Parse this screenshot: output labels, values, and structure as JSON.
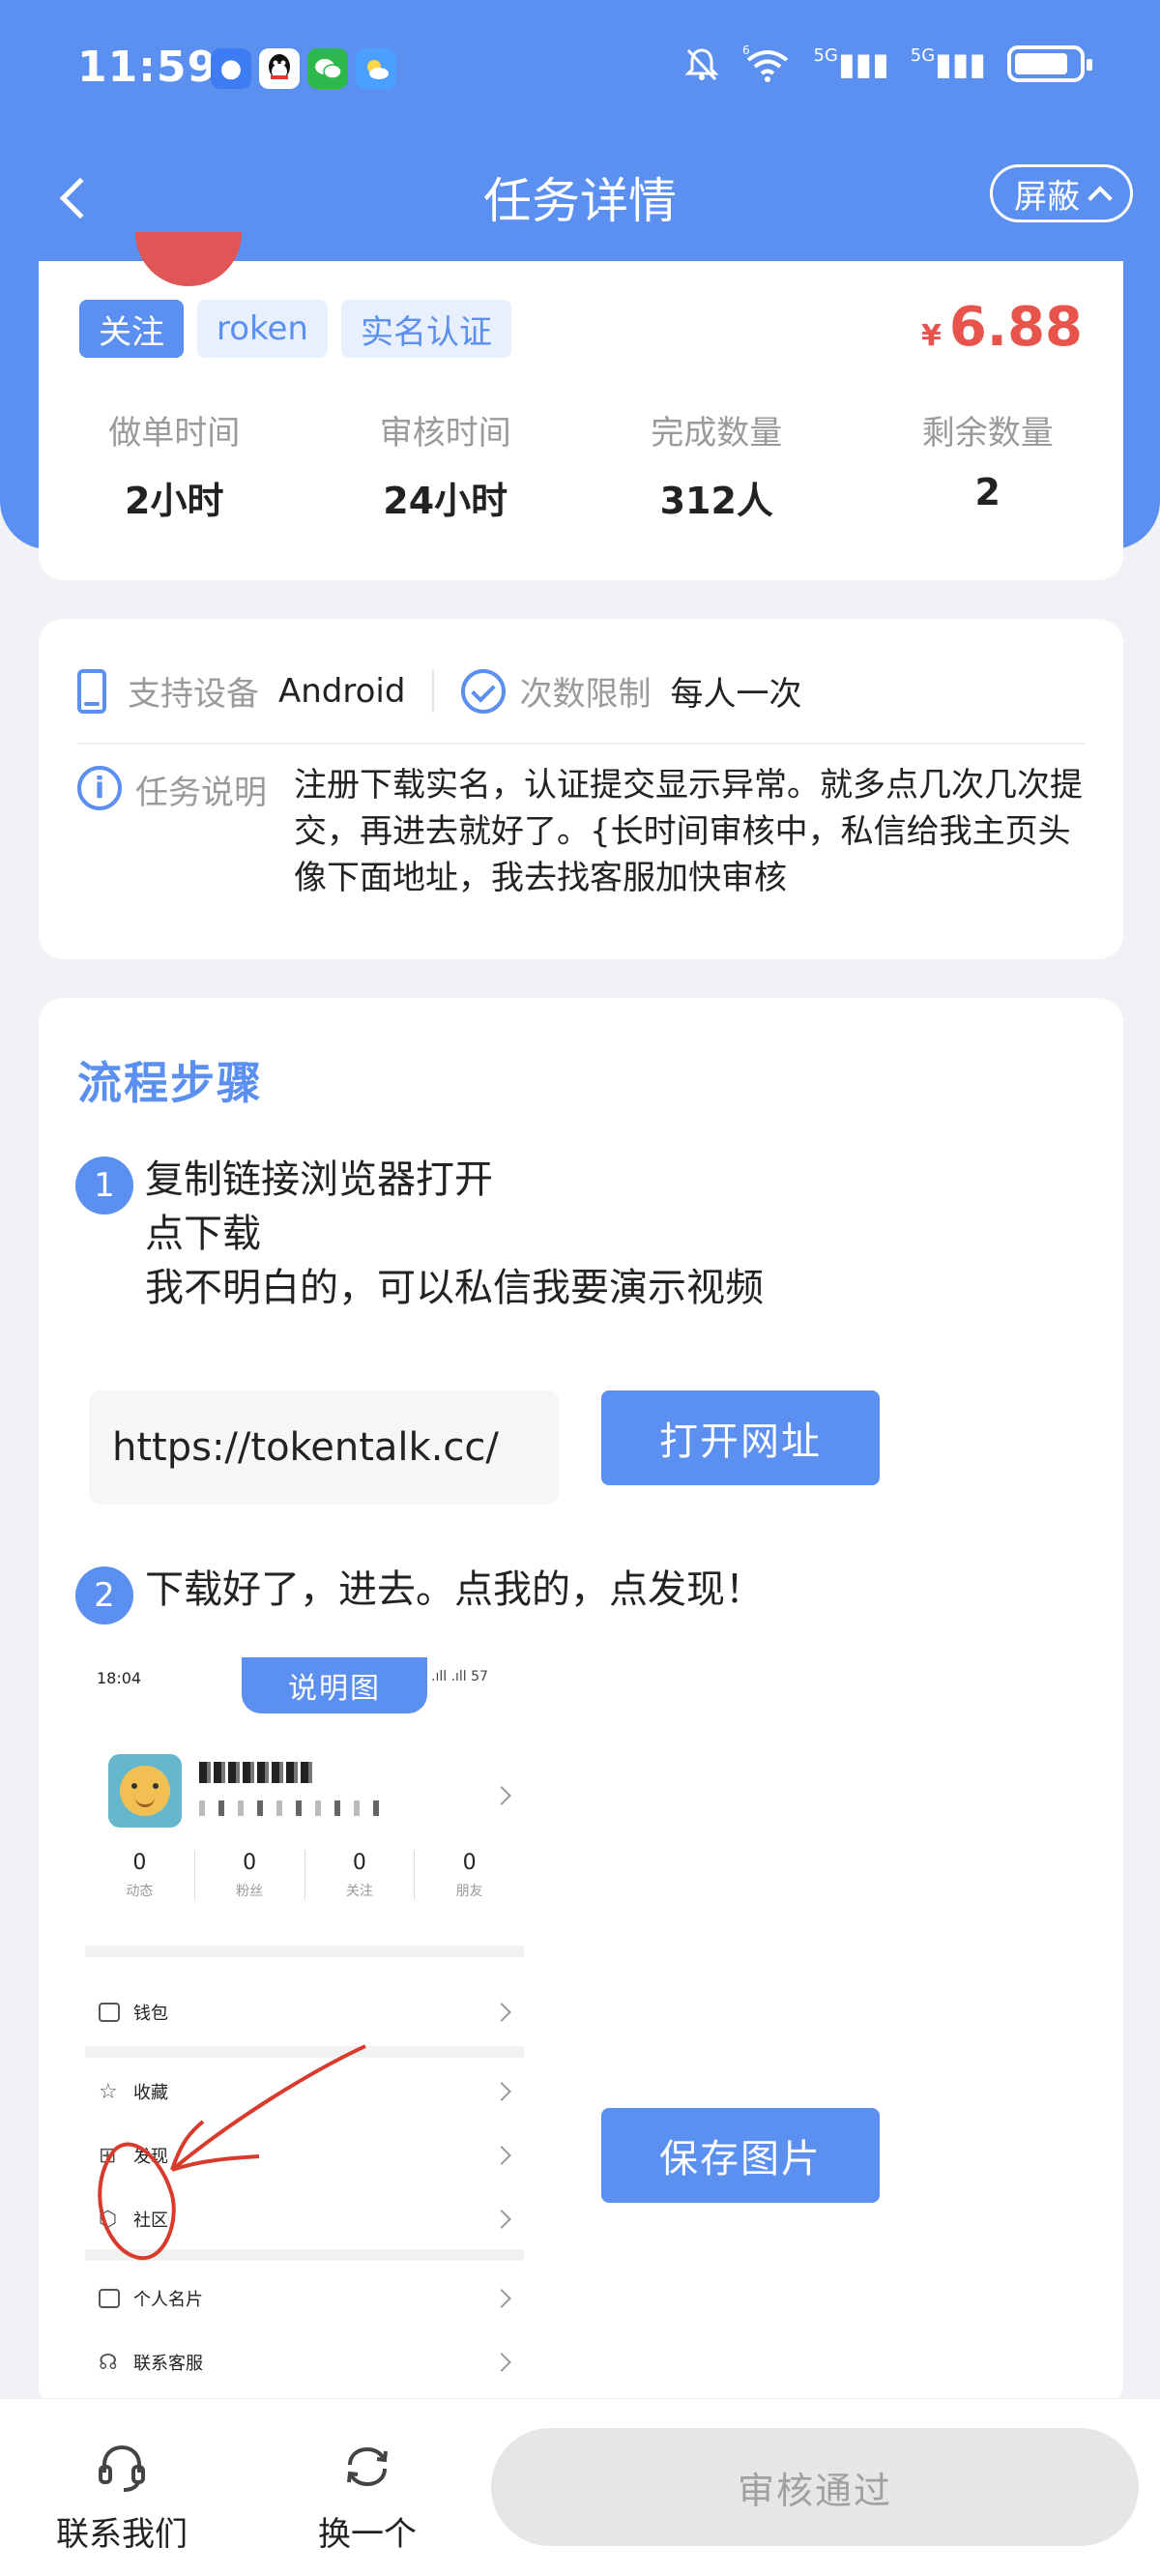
{
  "status_bar": {
    "time": "11:59",
    "signal_1": "5G",
    "signal_2": "5G",
    "wifi_badge": "6"
  },
  "nav": {
    "title": "任务详情",
    "shield_label": "屏蔽"
  },
  "summary": {
    "tags": [
      "关注",
      "roken",
      "实名认证"
    ],
    "currency": "¥",
    "price": "6.88",
    "stats": [
      {
        "label": "做单时间",
        "value": "2小时"
      },
      {
        "label": "审核时间",
        "value": "24小时"
      },
      {
        "label": "完成数量",
        "value": "312人"
      },
      {
        "label": "剩余数量",
        "value": "2"
      }
    ]
  },
  "info": {
    "device_label": "支持设备",
    "device_value": "Android",
    "limit_label": "次数限制",
    "limit_value": "每人一次",
    "desc_label": "任务说明",
    "desc_text": "注册下载实名，认证提交显示异常。就多点几次几次提交，再进去就好了。{长时间审核中，私信给我主页头像下面地址，我去找客服加快审核"
  },
  "steps": {
    "title": "流程步骤",
    "step1_num": "1",
    "step1_lines": [
      "复制链接浏览器打开",
      "点下载",
      "我不明白的，可以私信我要演示视频"
    ],
    "url": "https://tokentalk.cc/",
    "open_button": "打开网址",
    "step2_num": "2",
    "step2_text": "下载好了，进去。点我的，点发现！",
    "save_button": "保存图片",
    "sample_image": {
      "banner": "说明图",
      "time": "18:04",
      "battery": "57",
      "stats": [
        {
          "num": "0",
          "label": "动态"
        },
        {
          "num": "0",
          "label": "粉丝"
        },
        {
          "num": "0",
          "label": "关注"
        },
        {
          "num": "0",
          "label": "朋友"
        }
      ],
      "menu": [
        "钱包",
        "收藏",
        "发现",
        "社区",
        "个人名片",
        "联系客服"
      ]
    }
  },
  "bottom": {
    "contact_label": "联系我们",
    "switch_label": "换一个",
    "approve_label": "审核通过"
  },
  "colors": {
    "primary": "#5b8ff0",
    "price": "#e8534b"
  }
}
